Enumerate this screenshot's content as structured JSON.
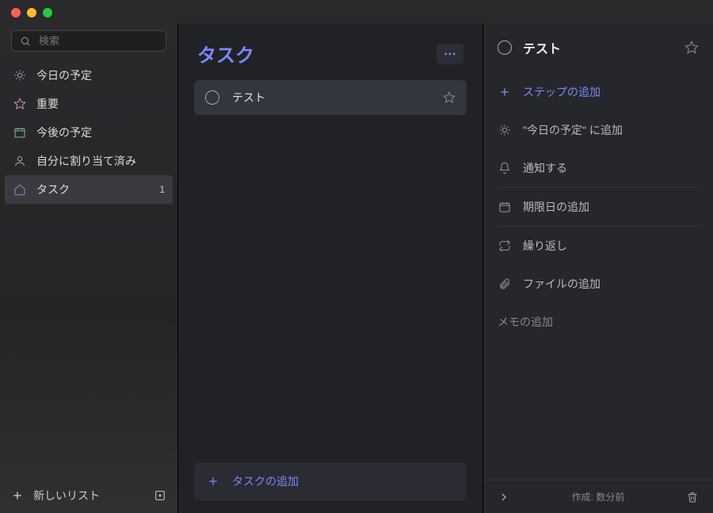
{
  "search": {
    "placeholder": "検索"
  },
  "sidebar": {
    "items": [
      {
        "label": "今日の予定",
        "icon": "sun-icon"
      },
      {
        "label": "重要",
        "icon": "star-icon"
      },
      {
        "label": "今後の予定",
        "icon": "calendar-icon"
      },
      {
        "label": "自分に割り当て済み",
        "icon": "user-icon"
      },
      {
        "label": "タスク",
        "icon": "home-icon",
        "count": "1",
        "active": true
      }
    ],
    "new_list": "新しいリスト"
  },
  "main": {
    "title": "タスク",
    "add_task": "タスクの追加",
    "tasks": [
      {
        "title": "テスト"
      }
    ]
  },
  "detail": {
    "title": "テスト",
    "add_step": "ステップの追加",
    "add_to_my_day": "\"今日の予定\" に追加",
    "remind": "通知する",
    "add_due": "期限日の追加",
    "repeat": "繰り返し",
    "add_file": "ファイルの追加",
    "add_note": "メモの追加",
    "created": "作成: 数分前"
  }
}
